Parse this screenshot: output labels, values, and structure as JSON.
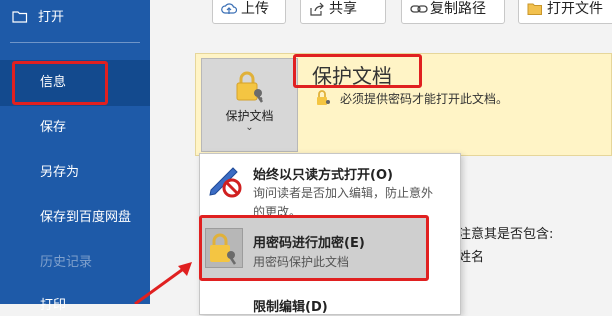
{
  "sidebar": {
    "open_label": "打开",
    "items": [
      {
        "label": "信息"
      },
      {
        "label": "保存"
      },
      {
        "label": "另存为"
      },
      {
        "label": "保存到百度网盘"
      },
      {
        "label": "历史记录"
      },
      {
        "label": "打印"
      }
    ]
  },
  "toolbar": {
    "upload_label": "上传",
    "share_label": "共享",
    "copy_path_label": "复制路径",
    "open_location_label": "打开文件"
  },
  "protect_panel": {
    "button_label": "保护文档",
    "chevron": "⌄",
    "title": "保护文档",
    "description": "必须提供密码才能打开此文档。"
  },
  "menu": {
    "readonly_title": "始终以只读方式打开(O)",
    "readonly_desc": "询问读者是否加入编辑，防止意外的更改。",
    "encrypt_title": "用密码进行加密(E)",
    "encrypt_desc": "用密码保护此文档",
    "restrict_title": "限制编辑(D)"
  },
  "background": {
    "inspect_text": "注意其是否包含:",
    "author_text": "姓名"
  },
  "colors": {
    "sidebar_bg": "#1e5aa8",
    "sidebar_selected": "#134a8e",
    "highlight_red": "#e02020",
    "panel_yellow": "#fff4c6"
  }
}
